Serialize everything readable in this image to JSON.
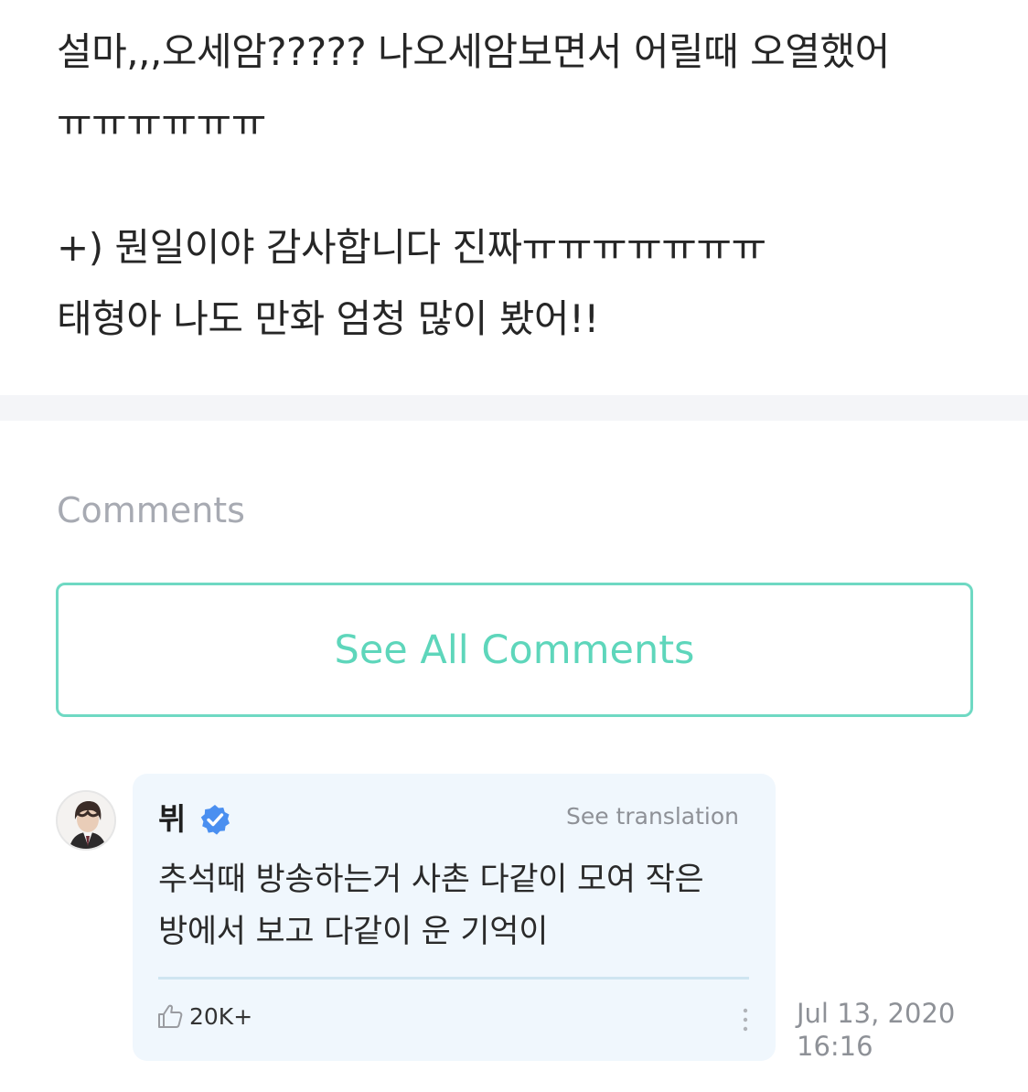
{
  "post": {
    "lines": [
      "설마,,,오세암????? 나오세암보면서 어릴때 오열했어",
      "ㅠㅠㅠㅠㅠㅠ",
      "+) 뭔일이야 감사합니다 진짜ㅠㅠㅠㅠㅠㅠㅠ",
      "태형아 나도 만화 엄청 많이 봤어!!"
    ]
  },
  "comments_section": {
    "heading": "Comments",
    "see_all_label": "See All Comments"
  },
  "comment": {
    "author": "뷔",
    "verified": true,
    "translate_label": "See translation",
    "text_lines": [
      "추석때 방송하는거 사촌 다같이 모여 작은",
      "방에서 보고 다같이 운 기억이"
    ],
    "likes": "20K+",
    "date": "Jul 13, 2020",
    "time": "16:16"
  },
  "icons": {
    "verified": "verified-badge-icon",
    "like": "thumbs-up-icon",
    "more": "more-vertical-icon"
  },
  "colors": {
    "accent": "#5ed6bb",
    "verified_blue": "#4a8ff0",
    "card_background": "#f0f7fd",
    "muted_text": "#8e9197"
  }
}
